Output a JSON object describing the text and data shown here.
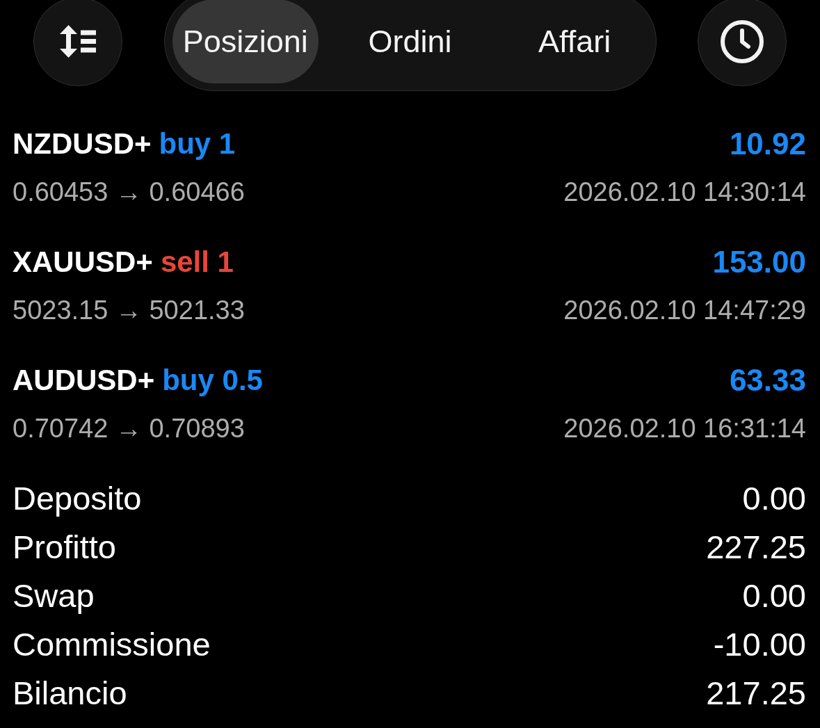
{
  "tabs": [
    {
      "label": "Posizioni",
      "selected": true
    },
    {
      "label": "Ordini",
      "selected": false
    },
    {
      "label": "Affari",
      "selected": false
    }
  ],
  "positions": [
    {
      "symbol": "NZDUSD+",
      "trade": "buy 1",
      "kind": "buy",
      "profit": "10.92",
      "prices": "0.60453 → 0.60466",
      "time": "2026.02.10 14:30:14"
    },
    {
      "symbol": "XAUUSD+",
      "trade": "sell 1",
      "kind": "sell",
      "profit": "153.00",
      "prices": "5023.15 → 5021.33",
      "time": "2026.02.10 14:47:29"
    },
    {
      "symbol": "AUDUSD+",
      "trade": "buy 0.5",
      "kind": "buy",
      "profit": "63.33",
      "prices": "0.70742 → 0.70893",
      "time": "2026.02.10 16:31:14"
    }
  ],
  "summary": [
    {
      "label": "Deposito",
      "value": "0.00"
    },
    {
      "label": "Profitto",
      "value": "227.25"
    },
    {
      "label": "Swap",
      "value": "0.00"
    },
    {
      "label": "Commissione",
      "value": "-10.00"
    },
    {
      "label": "Bilancio",
      "value": "217.25"
    }
  ]
}
